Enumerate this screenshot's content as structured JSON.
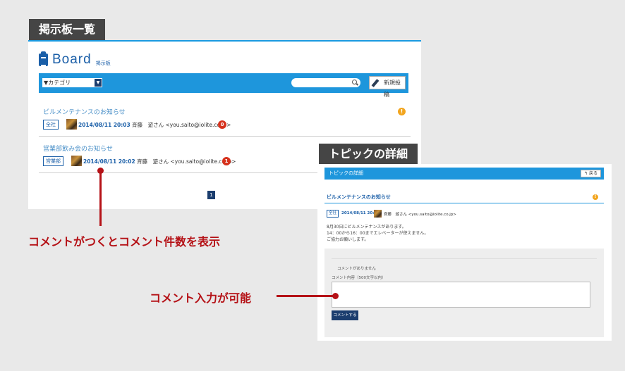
{
  "labels": {
    "board_list": "掲示板一覧",
    "topic_detail": "トピックの詳細"
  },
  "board": {
    "title": "Board",
    "subtitle": "掲示板",
    "category_placeholder": "▼カテゴリ",
    "new_post_label": "新規投稿",
    "topics": [
      {
        "title": "ビルメンテナンスのお知らせ",
        "category": "全社",
        "datetime": "2014/08/11 20:03",
        "author": "斉藤　遊さん <you.saito@iolite.co.jp>",
        "comment_count": "0",
        "alert": "!"
      },
      {
        "title": "営業部飲み会のお知らせ",
        "category": "営業部",
        "datetime": "2014/08/11 20:02",
        "author": "斉藤　遊さん <you.saito@iolite.co.jp>",
        "comment_count": "1"
      }
    ],
    "page": "1"
  },
  "detail": {
    "header": "トピックの詳細",
    "back_label": "戻る",
    "title": "ビルメンテナンスのお知らせ",
    "alert": "!",
    "category": "全社",
    "datetime": "2014/08/11 20:03",
    "author": "斉藤　遊さん <you.saito@iolite.co.jp>",
    "body": [
      "8月30日にビルメンテナンスがあります。",
      "14：00から16：00までエレベーターが使えません。",
      "ご協力お願いします。"
    ],
    "no_comments": "コメントがありません",
    "comment_label": "コメント内容（500文字以内）",
    "submit_label": "コメントする"
  },
  "callouts": {
    "comment_count": "コメントがつくとコメント件数を表示",
    "comment_input": "コメント入力が可能"
  },
  "colors": {
    "accent": "#1e96dc",
    "navy": "#1b3d6e",
    "callout": "#b51217",
    "count_badge": "#d6321d",
    "alert": "#f2a51e"
  }
}
